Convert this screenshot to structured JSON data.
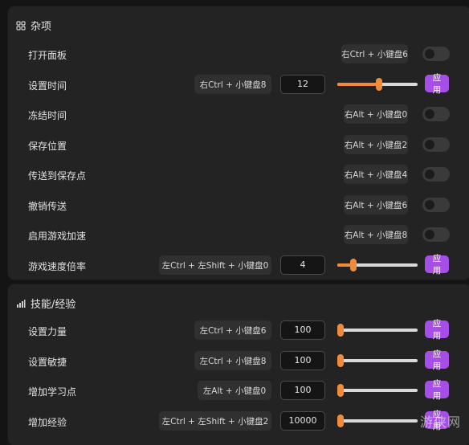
{
  "sections": {
    "misc": {
      "title": "杂项",
      "icon": "grid-icon",
      "rows": [
        {
          "label": "打开面板",
          "hotkey": "右Ctrl + 小键盘6",
          "control": "toggle"
        },
        {
          "label": "设置时间",
          "hotkey": "右Ctrl + 小键盘8",
          "control": "slider",
          "value": "12",
          "slider_fraction": 0.52,
          "apply": "应用"
        },
        {
          "label": "冻结时间",
          "hotkey": "右Alt + 小键盘0",
          "control": "toggle"
        },
        {
          "label": "保存位置",
          "hotkey": "右Alt + 小键盘2",
          "control": "toggle"
        },
        {
          "label": "传送到保存点",
          "hotkey": "右Alt + 小键盘4",
          "control": "toggle"
        },
        {
          "label": "撤销传送",
          "hotkey": "右Alt + 小键盘6",
          "control": "toggle"
        },
        {
          "label": "启用游戏加速",
          "hotkey": "右Alt + 小键盘8",
          "control": "toggle"
        },
        {
          "label": "游戏速度倍率",
          "hotkey": "左Ctrl + 左Shift + 小键盘0",
          "control": "slider",
          "value": "4",
          "slider_fraction": 0.2,
          "apply": "应用"
        }
      ]
    },
    "skills": {
      "title": "技能/经验",
      "icon": "bar-chart-icon",
      "rows": [
        {
          "label": "设置力量",
          "hotkey": "左Ctrl + 小键盘6",
          "control": "slider",
          "value": "100",
          "slider_fraction": 0.02,
          "apply": "应用"
        },
        {
          "label": "设置敏捷",
          "hotkey": "左Ctrl + 小键盘8",
          "control": "slider",
          "value": "100",
          "slider_fraction": 0.02,
          "apply": "应用"
        },
        {
          "label": "增加学习点",
          "hotkey": "左Alt + 小键盘0",
          "control": "slider",
          "value": "100",
          "slider_fraction": 0.02,
          "apply": "应用"
        },
        {
          "label": "增加经验",
          "hotkey": "左Ctrl + 左Shift + 小键盘2",
          "control": "slider",
          "value": "10000",
          "slider_fraction": 0.02,
          "apply": "应用"
        }
      ]
    }
  },
  "watermark": "游侠网",
  "colors": {
    "accent_orange": "#f08a3c",
    "apply_purple": "#a64ee8",
    "panel_bg": "#232323"
  }
}
